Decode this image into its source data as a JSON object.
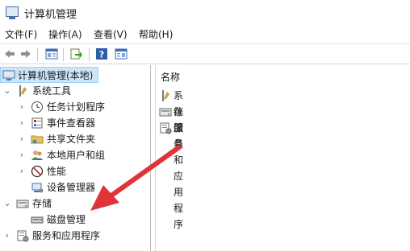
{
  "window": {
    "title": "计算机管理"
  },
  "menubar": [
    {
      "label": "文件(F)"
    },
    {
      "label": "操作(A)"
    },
    {
      "label": "查看(V)"
    },
    {
      "label": "帮助(H)"
    }
  ],
  "tree": [
    {
      "label": "计算机管理(本地)",
      "icon": "computer-management-icon"
    },
    {
      "label": "系统工具",
      "icon": "tools-icon"
    },
    {
      "label": "任务计划程序",
      "icon": "clock-icon"
    },
    {
      "label": "事件查看器",
      "icon": "event-viewer-icon"
    },
    {
      "label": "共享文件夹",
      "icon": "shared-folder-icon"
    },
    {
      "label": "本地用户和组",
      "icon": "users-icon"
    },
    {
      "label": "性能",
      "icon": "performance-icon"
    },
    {
      "label": "设备管理器",
      "icon": "device-manager-icon"
    },
    {
      "label": "存储",
      "icon": "storage-icon"
    },
    {
      "label": "磁盘管理",
      "icon": "disk-icon"
    },
    {
      "label": "服务和应用程序",
      "icon": "services-icon"
    }
  ],
  "list": {
    "column_header": "名称",
    "items": [
      {
        "label": "系统工具",
        "icon": "tools-icon"
      },
      {
        "label": "存储",
        "icon": "storage-icon"
      },
      {
        "label": "服务和应用程序",
        "icon": "services-icon"
      }
    ]
  },
  "colors": {
    "annotation_arrow": "#e0343a",
    "selection": "#cde6f7"
  }
}
